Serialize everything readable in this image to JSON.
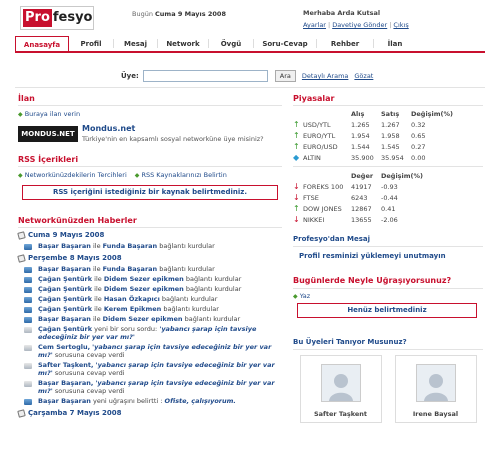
{
  "header": {
    "logo_part1": "Pro",
    "logo_part2": "fesyo",
    "date_prefix": "Bugün",
    "date_value": "Cuma 9 Mayıs 2008",
    "greeting": "Merhaba Arda Kutsal",
    "links": [
      "Ayarlar",
      "Davetiye Gönder",
      "Çıkış"
    ]
  },
  "nav": {
    "tabs": [
      "Anasayfa",
      "Profil",
      "Mesaj",
      "Network",
      "Övgü",
      "Soru-Cevap",
      "Rehber",
      "İlan"
    ],
    "active": "Anasayfa"
  },
  "search": {
    "label": "Üye:",
    "button": "Ara",
    "link1": "Detaylı Arama",
    "link2": "Gözat"
  },
  "ilan": {
    "title": "İlan",
    "place_ad": "Buraya ilan verin",
    "logo_text": "MONDUS.NET",
    "ad_title": "Mondus.net",
    "ad_text": "Türkiye'nin en kapsamlı sosyal networküne üye misiniz?"
  },
  "rss": {
    "title": "RSS İçerikleri",
    "link1": "Networkünüzdekilerin Tercihleri",
    "link2": "RSS Kaynaklarınızı Belirtin",
    "notice": "RSS içeriğini istediğiniz bir kaynak belirtmediniz."
  },
  "news": {
    "title": "Networkünüzden Haberler",
    "date1": "Cuma 9 Mayıs 2008",
    "items1": [
      {
        "a": "Başar Başaran",
        "mid": "ile",
        "b": "Funda Başaran",
        "end": "bağlantı kurdular"
      }
    ],
    "date2": "Perşembe 8 Mayıs 2008",
    "items2": [
      {
        "a": "Başar Başaran",
        "mid": "ile",
        "b": "Funda Başaran",
        "end": "bağlantı kurdular"
      },
      {
        "a": "Çağan Şentürk",
        "mid": "ile",
        "b": "Didem Sezer epikmen",
        "end": "bağlantı kurdular"
      },
      {
        "a": "Çağan Şentürk",
        "mid": "ile",
        "b": "Didem Sezer epikmen",
        "end": "bağlantı kurdular"
      },
      {
        "a": "Çağan Şentürk",
        "mid": "ile",
        "b": "Hasan Özkapıcı",
        "end": "bağlantı kurdular"
      },
      {
        "a": "Çağan Şentürk",
        "mid": "ile",
        "b": "Kerem Epikmen",
        "end": "bağlantı kurdular"
      },
      {
        "a": "Başar Başaran",
        "mid": "ile",
        "b": "Didem Sezer epikmen",
        "end": "bağlantı kurdular"
      }
    ],
    "q1_name": "Çağan Şentürk",
    "q1_text": "yeni bir soru sordu:",
    "q1_question": "'yabancı şarap için tavsiye edeceğiniz bir yer var mı?'",
    "q2_name": "Cem Sertoglu,",
    "q2_question": "'yabancı şarap için tavsiye edeceğiniz bir yer var mı?'",
    "q2_text": "sorusuna cevap verdi",
    "q3_name": "Safter Taşkent,",
    "q3_question": "'yabancı şarap için tavsiye edeceğiniz bir yer var mı?'",
    "q3_text": "sorusuna cevap verdi",
    "q4_name": "Başar Başaran,",
    "q4_question": "'yabancı şarap için tavsiye edeceğiniz bir yer var mı?'",
    "q4_text": "sorusuna cevap verdi",
    "q5_name": "Başar Başaran",
    "q5_text": "yeni uğraşını belirtti :",
    "q5_value": "Ofiste, çalışıyorum.",
    "date3": "Çarşamba 7 Mayıs 2008"
  },
  "markets": {
    "title": "Piyasalar",
    "head1": [
      "Alış",
      "Satış",
      "Değişim(%)"
    ],
    "rows1": [
      {
        "dir": "up",
        "name": "USD/YTL",
        "a": "1.265",
        "b": "1.267",
        "c": "0.32"
      },
      {
        "dir": "up",
        "name": "EURO/YTL",
        "a": "1.954",
        "b": "1.958",
        "c": "0.65"
      },
      {
        "dir": "up",
        "name": "EURO/USD",
        "a": "1.544",
        "b": "1.545",
        "c": "0.27"
      },
      {
        "dir": "dia",
        "name": "ALTIN",
        "a": "35.900",
        "b": "35.954",
        "c": "0.00"
      }
    ],
    "head2": [
      "Değer",
      "Değişim(%)"
    ],
    "rows2": [
      {
        "dir": "down",
        "name": "FOREKS 100",
        "a": "41917",
        "c": "-0.93"
      },
      {
        "dir": "down",
        "name": "FTSE",
        "a": "6243",
        "c": "-0.44"
      },
      {
        "dir": "up",
        "name": "DOW JONES",
        "a": "12867",
        "c": "0.41"
      },
      {
        "dir": "down",
        "name": "NIKKEI",
        "a": "13655",
        "c": "-2.06"
      }
    ]
  },
  "message": {
    "title": "Profesyo'dan Mesaj",
    "text": "Profil resminizi yüklemeyi unutmayın"
  },
  "busy": {
    "title": "Bugünlerde Neyle Uğraşıyorsunuz?",
    "link": "Yaz",
    "notice": "Henüz belirtmediniz"
  },
  "people": {
    "title": "Bu Üyeleri Tanıyor Musunuz?",
    "p1": "Safter Taşkent",
    "p2": "Irene Baysal"
  }
}
